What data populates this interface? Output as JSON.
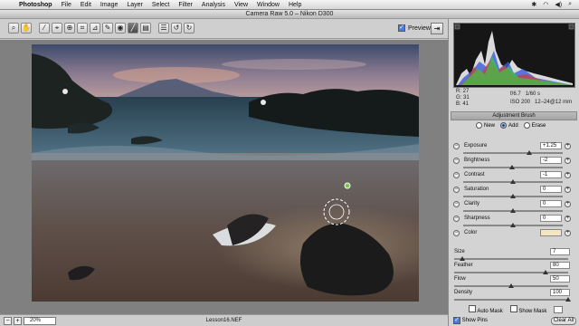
{
  "menubar": {
    "app": "Photoshop",
    "items": [
      "File",
      "Edit",
      "Image",
      "Layer",
      "Select",
      "Filter",
      "Analysis",
      "View",
      "Window",
      "Help"
    ]
  },
  "window": {
    "title": "Camera Raw 5.0  –  Nikon D300"
  },
  "toolbar": {
    "tools": [
      "zoom-tool",
      "hand-tool",
      "white-balance-tool",
      "color-sampler-tool",
      "targeted-adjustment-tool",
      "crop-tool",
      "straighten-tool",
      "spot-removal-tool",
      "red-eye-tool",
      "adjustment-brush-tool",
      "graduated-filter-tool",
      "preferences",
      "rotate-ccw",
      "rotate-cw"
    ],
    "preview_label": "Preview",
    "preview_checked": true
  },
  "readout": {
    "r_label": "R:",
    "r": "27",
    "g_label": "G:",
    "g": "31",
    "b_label": "B:",
    "b": "41",
    "aperture": "f/6.7",
    "shutter": "1/60 s",
    "iso": "ISO 200",
    "lens": "12–24@12 mm"
  },
  "panel": {
    "title": "Adjustment Brush",
    "modes": [
      {
        "label": "New",
        "selected": false
      },
      {
        "label": "Add",
        "selected": true
      },
      {
        "label": "Erase",
        "selected": false
      }
    ],
    "adjustments": [
      {
        "label": "Exposure",
        "value": "+1.25",
        "level": 0.66
      },
      {
        "label": "Brightness",
        "value": "-2",
        "level": 0.49
      },
      {
        "label": "Contrast",
        "value": "-1",
        "level": 0.5
      },
      {
        "label": "Saturation",
        "value": "0",
        "level": 0.5
      },
      {
        "label": "Clarity",
        "value": "0",
        "level": 0.5
      },
      {
        "label": "Sharpness",
        "value": "0",
        "level": 0.5
      },
      {
        "label": "Color",
        "value": "",
        "level": null
      }
    ],
    "brush": [
      {
        "label": "Size",
        "value": "7",
        "level": 0.07
      },
      {
        "label": "Feather",
        "value": "80",
        "level": 0.8
      },
      {
        "label": "Flow",
        "value": "50",
        "level": 0.5
      },
      {
        "label": "Density",
        "value": "100",
        "level": 1.0
      }
    ],
    "auto_mask_label": "Auto Mask",
    "auto_mask_checked": false,
    "show_mask_label": "Show Mask",
    "show_mask_checked": false,
    "show_pins_label": "Show Pins",
    "show_pins_checked": true,
    "clear_all_label": "Clear All",
    "color_swatch": "#f5e6bf"
  },
  "status": {
    "zoom": "20%",
    "filename": "Lesson16.NEF"
  }
}
